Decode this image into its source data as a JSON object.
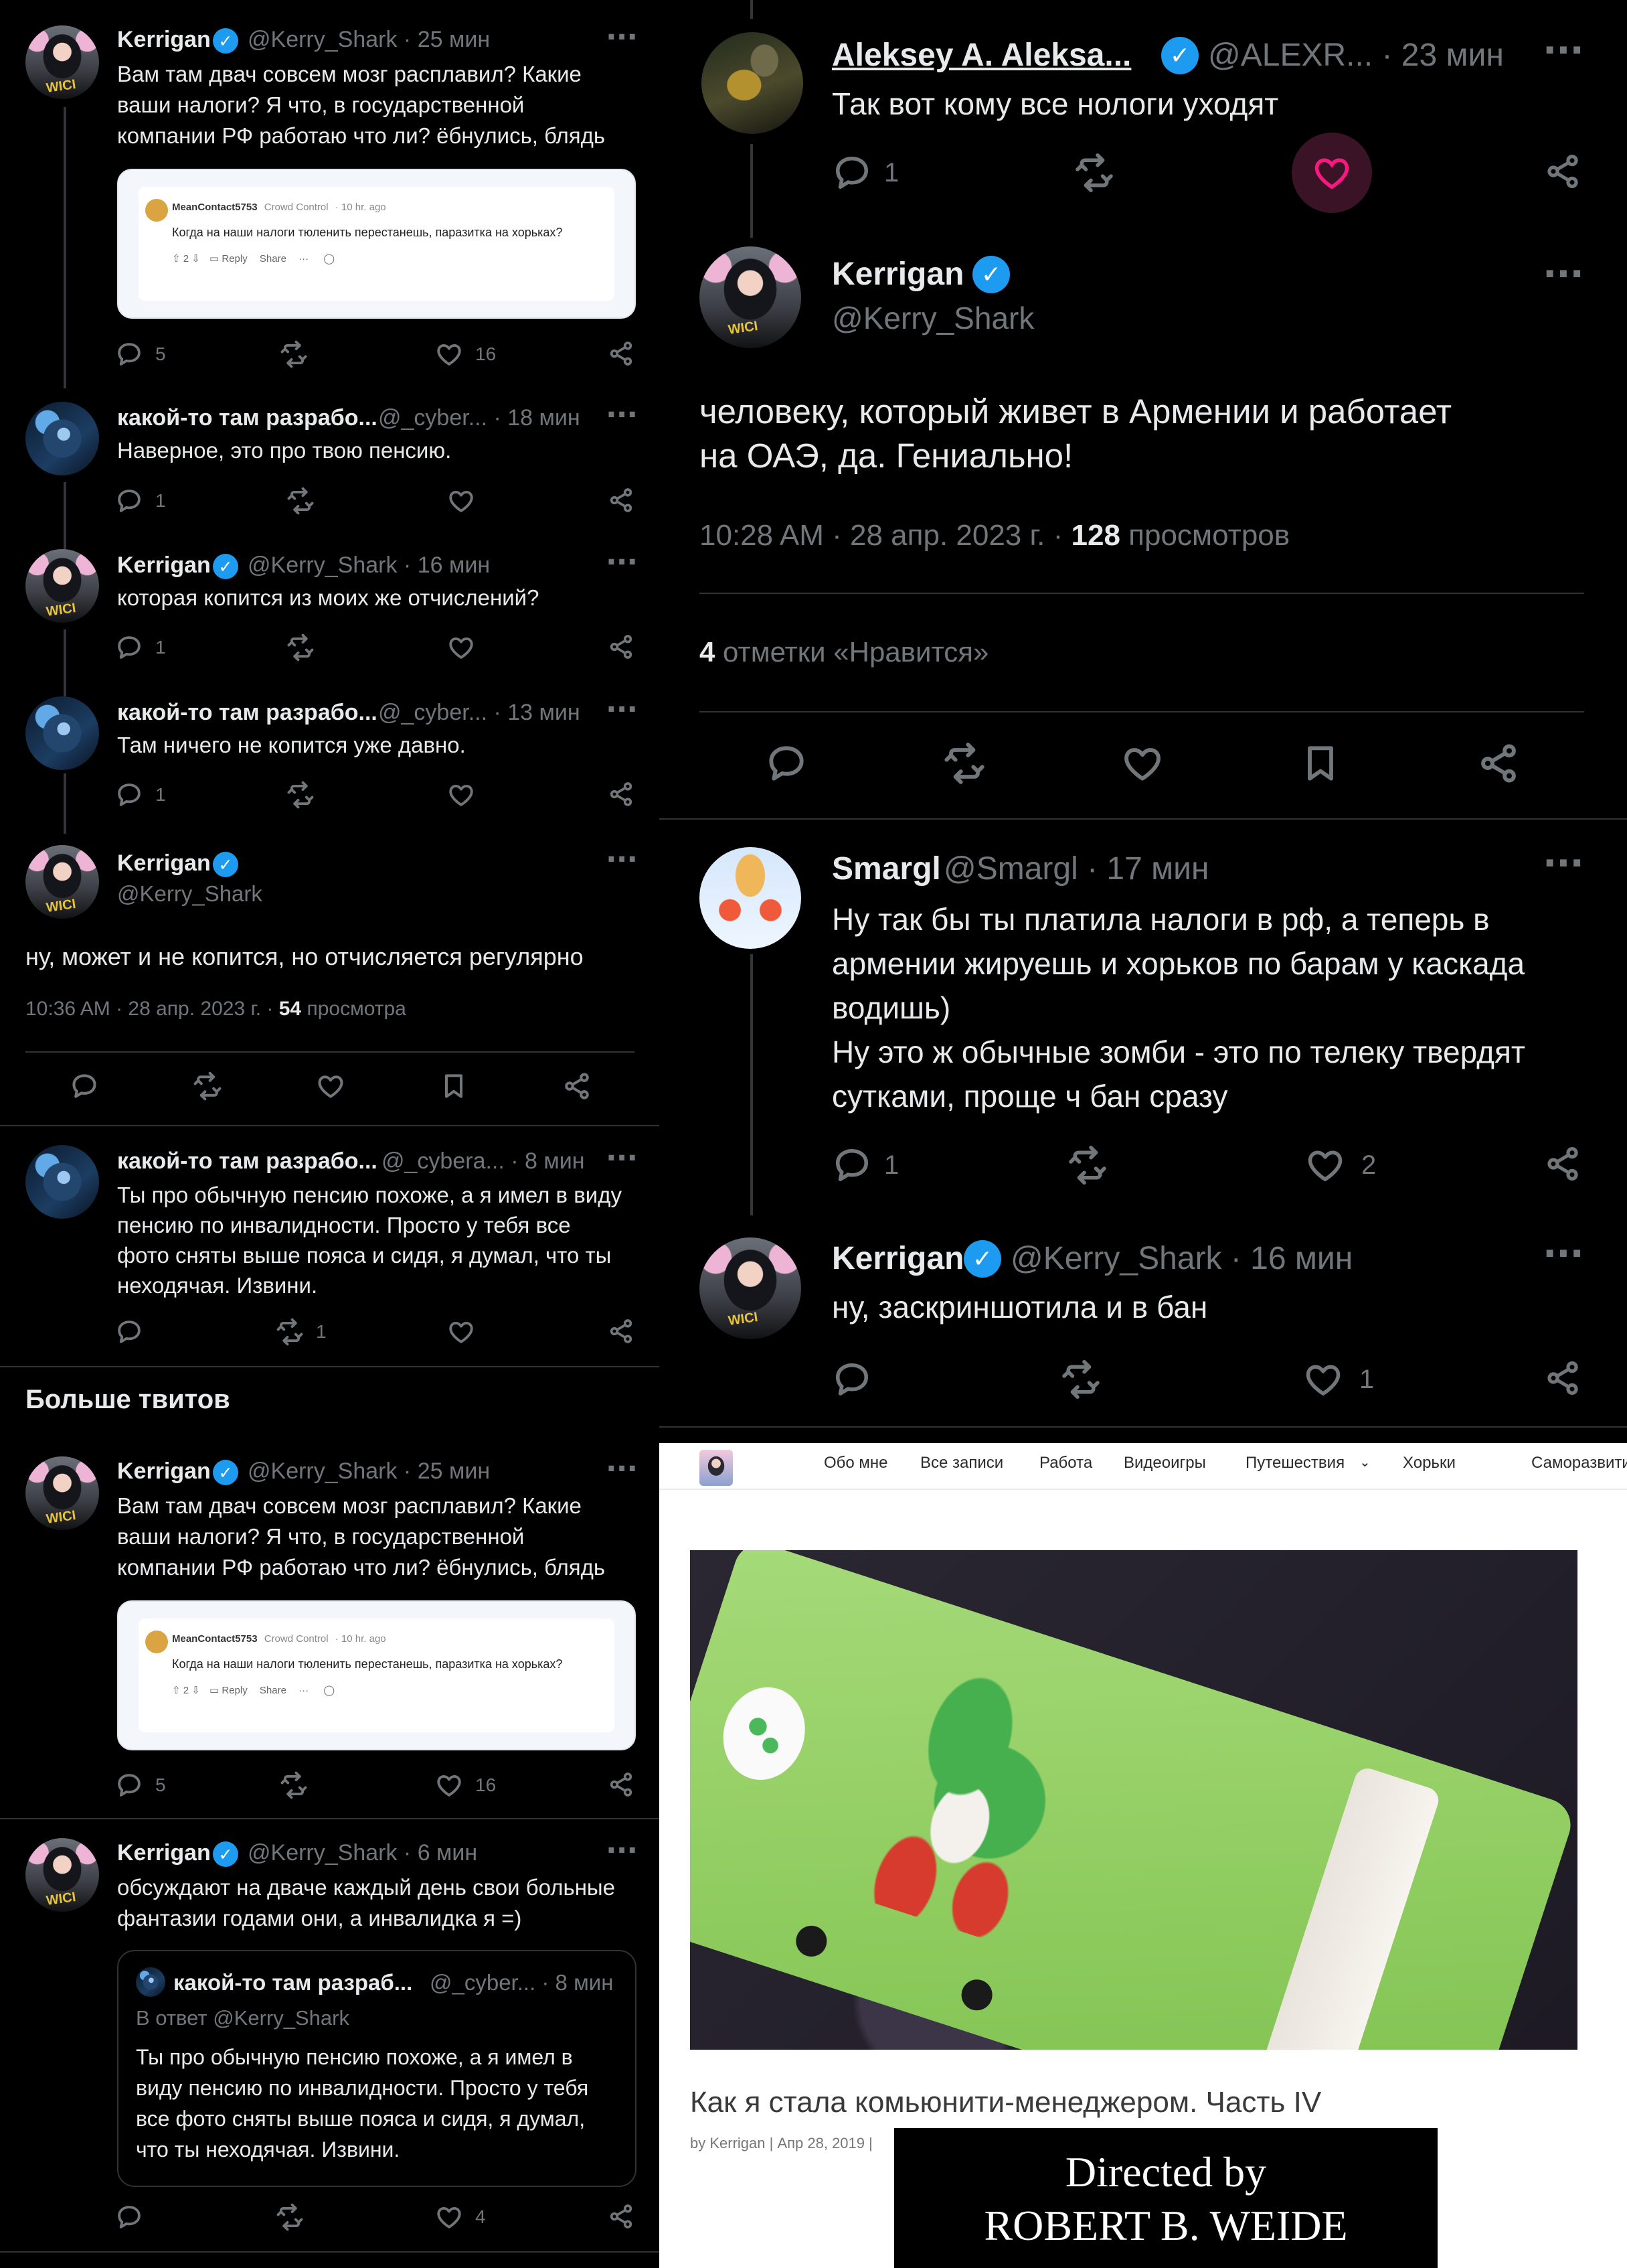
{
  "left_thread": {
    "tweet1": {
      "name": "Kerrigan",
      "handle": "@Kerry_Shark · 25 мин",
      "text": "Вам там двач совсем мозг расплавил? Какие\nваши налоги? Я что, в государственной\nкомпании РФ работаю что ли? ёбнулись, блядь",
      "replies": "5",
      "likes": "16"
    },
    "embed": {
      "user": "MeanContact5753",
      "flair": "Crowd Control",
      "time": "· 10 hr. ago",
      "text": "Когда на наши налоги тюленить перестанешь, паразитка на хорьках?",
      "votes": "2",
      "reply": "Reply",
      "share": "Share"
    },
    "tweet2": {
      "name": "какой-то там разрабо...",
      "handle": "@_cyber... · 18 мин",
      "text": "Наверное, это про твою пенсию.",
      "replies": "1"
    },
    "tweet3": {
      "name": "Kerrigan",
      "handle": "@Kerry_Shark · 16 мин",
      "text": "которая копится из моих же отчислений?",
      "replies": "1"
    },
    "tweet4": {
      "name": "какой-то там разрабо...",
      "handle": "@_cyber... · 13 мин",
      "text": "Там ничего не копится уже давно.",
      "replies": "1"
    },
    "main": {
      "name": "Kerrigan",
      "handle": "@Kerry_Shark",
      "text": "ну, может и не копится, но отчисляется регулярно",
      "meta_prefix": "10:36 AM · 28 апр. 2023 г. · ",
      "views": "54",
      "views_label": " просмотра"
    },
    "tweet5": {
      "name": "какой-то там разрабо...",
      "handle": "@_cybera... · 8 мин",
      "text": "Ты про обычную пенсию похоже, а я имел в виду\nпенсию по инвалидности. Просто у тебя все\nфото сняты выше пояса и сидя, я думал, что ты\nнеходячая. Извини.",
      "retweets": "1"
    },
    "more_title": "Больше твитов",
    "tweet6": {
      "name": "Kerrigan",
      "handle": "@Kerry_Shark · 25 мин",
      "text": "Вам там двач совсем мозг расплавил? Какие\nваши налоги? Я что, в государственной\nкомпании РФ работаю что ли? ёбнулись, блядь",
      "replies": "5",
      "likes": "16"
    },
    "tweet7": {
      "name": "Kerrigan",
      "handle": "@Kerry_Shark · 6 мин",
      "text": "обсуждают на дваче каждый день свои больные\nфантазии годами они, а инвалидка я =)",
      "likes": "4"
    },
    "quote": {
      "name": "какой-то там разраб...",
      "handle": "@_cyber... · 8 мин",
      "reply_to": "В ответ @Kerry_Shark",
      "text": "Ты про обычную пенсию похоже, а я имел в\nвиду пенсию по инвалидности. Просто у тебя\nвсе фото сняты выше пояса и сидя, я думал,\nчто ты неходячая. Извини."
    }
  },
  "right_thread": {
    "tweet1": {
      "name": "Aleksey A. Aleksa...",
      "handle": "@ALEXR... · 23 мин",
      "text": "Так вот кому все нологи уходят",
      "replies": "1"
    },
    "main": {
      "name": "Kerrigan",
      "handle": "@Kerry_Shark",
      "text": "человеку, который живет в Армении и работает\nна ОАЭ, да. Гениально!",
      "meta_prefix": "10:28 AM · 28 апр. 2023 г. · ",
      "views": "128",
      "views_label": " просмотров",
      "likes_count": "4",
      "likes_label": " отметки «Нравится»"
    },
    "tweet2": {
      "name": "Smargl",
      "handle": "@Smargl · 17 мин",
      "text": "Ну так бы ты платила налоги в рф, а теперь в\nармении жируешь и хорьков по барам у каскада\nводишь)\nНу это ж обычные зомби - это по телеку твердят\nсутками, проще ч бан сразу",
      "replies": "1",
      "likes": "2"
    },
    "tweet3": {
      "name": "Kerrigan",
      "handle": "@Kerry_Shark · 16 мин",
      "text": "ну, заскриншотила и в бан",
      "likes": "1"
    }
  },
  "blog": {
    "nav": [
      "Обо мне",
      "Все записи",
      "Работа",
      "Видеоигры",
      "Путешествия",
      "Хорьки",
      "Саморазвитие"
    ],
    "post_title": "Как я стала комьюнити-менеджером. Часть IV",
    "post_meta": "by Kerrigan | Апр 28, 2019 |"
  },
  "credit": {
    "line1": "Directed by",
    "line2": "ROBERT B. WEIDE"
  },
  "colors": {
    "background": "#000000",
    "text": "#e7e9ea",
    "muted": "#71767b",
    "verified": "#1d9bf0",
    "like_active": "#f91880",
    "divider": "#2f3336"
  }
}
